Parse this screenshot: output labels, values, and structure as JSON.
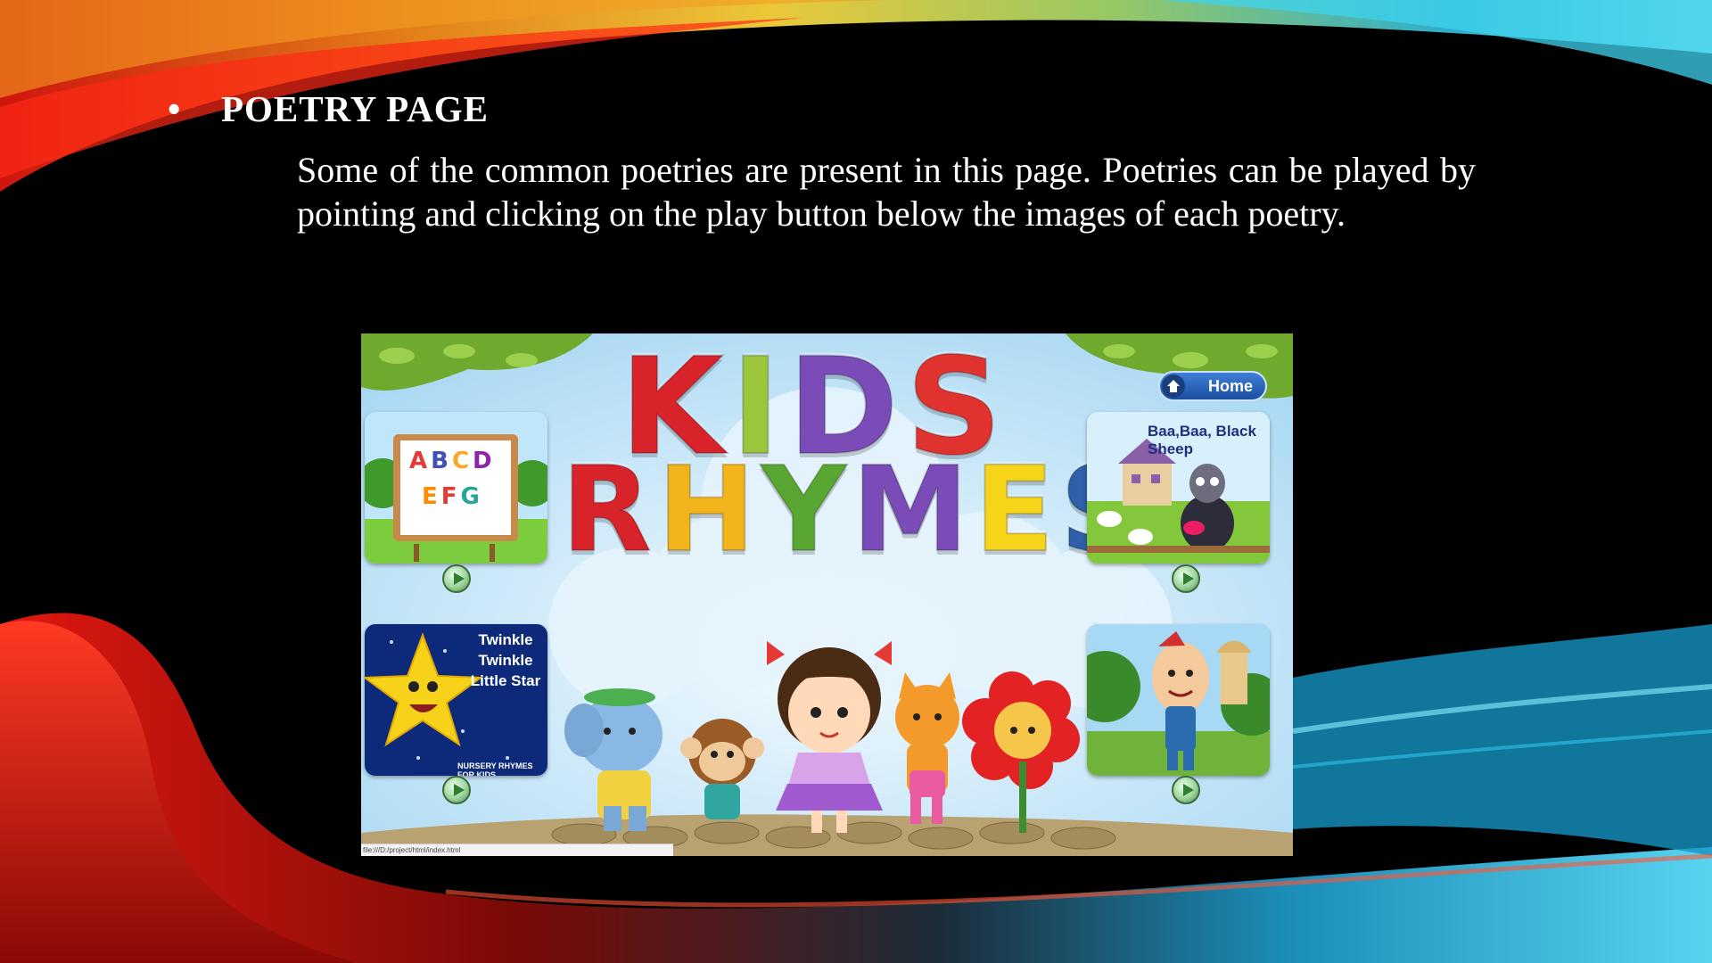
{
  "slide": {
    "bullet": "•",
    "heading": "POETRY PAGE",
    "body": "Some of the common poetries are present in this page. Poetries can be played by pointing and clicking on the play button below the images of each poetry."
  },
  "app": {
    "title_line1": "KIDS",
    "title_line2": "RHYMES",
    "home_label": "Home",
    "status_url": "file:///D:/project/html/index.html",
    "cards": {
      "abc": {
        "line1": "ABCD",
        "line2": "EFG"
      },
      "twinkle": {
        "title": "Twinkle Twinkle Little Star",
        "footer": "NURSERY RHYMES FOR KIDS"
      },
      "baa": {
        "title": "Baa,Baa, Black Sheep"
      },
      "humpty": {}
    }
  },
  "colors": {
    "letters": [
      "#d8232a",
      "#9bc53d",
      "#7b4bb7",
      "#e0332f",
      "#d8232a",
      "#f2b41b",
      "#5aa632",
      "#7b4bb7",
      "#f5d41a",
      "#2e5fa8"
    ]
  }
}
